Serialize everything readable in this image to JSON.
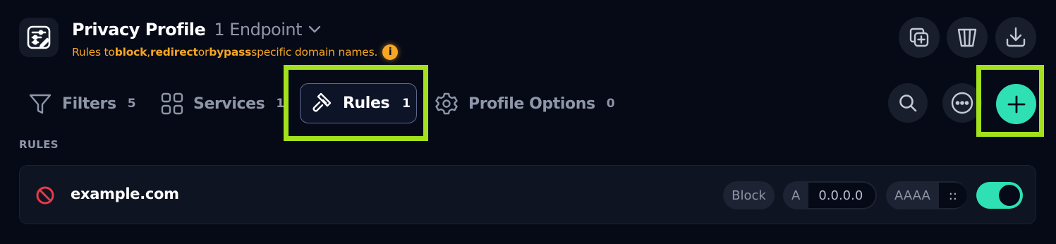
{
  "header": {
    "title": "Privacy Profile",
    "endpoint": "1 Endpoint",
    "subtitle": {
      "prefix": "Rules to ",
      "block": "block",
      "sep1": ", ",
      "redirect": "redirect",
      "sep2": " or ",
      "bypass": "bypass",
      "suffix": " specific domain names."
    },
    "info_glyph": "i"
  },
  "header_actions": [
    "duplicate-icon",
    "trash-icon",
    "download-icon"
  ],
  "tabs": [
    {
      "label": "Filters",
      "count": "5",
      "icon": "funnel-icon"
    },
    {
      "label": "Services",
      "count": "1",
      "icon": "grid-icon"
    },
    {
      "label": "Rules",
      "count": "1",
      "icon": "gavel-icon",
      "active": true
    },
    {
      "label": "Profile Options",
      "count": "0",
      "icon": "gear-icon"
    }
  ],
  "toolbar": [
    "search-icon",
    "more-icon",
    "add-icon"
  ],
  "section_label": "RULES",
  "rules": [
    {
      "domain": "example.com",
      "action": "Block",
      "a_label": "A",
      "a_value": "0.0.0.0",
      "aaaa_label": "AAAA",
      "aaaa_value": "::",
      "enabled": true
    }
  ],
  "colors": {
    "background": "#060a17",
    "accent_orange": "#f5a623",
    "accent_green": "#2fe0b4",
    "highlight": "#a2e11c",
    "block_red": "#e8394a"
  }
}
